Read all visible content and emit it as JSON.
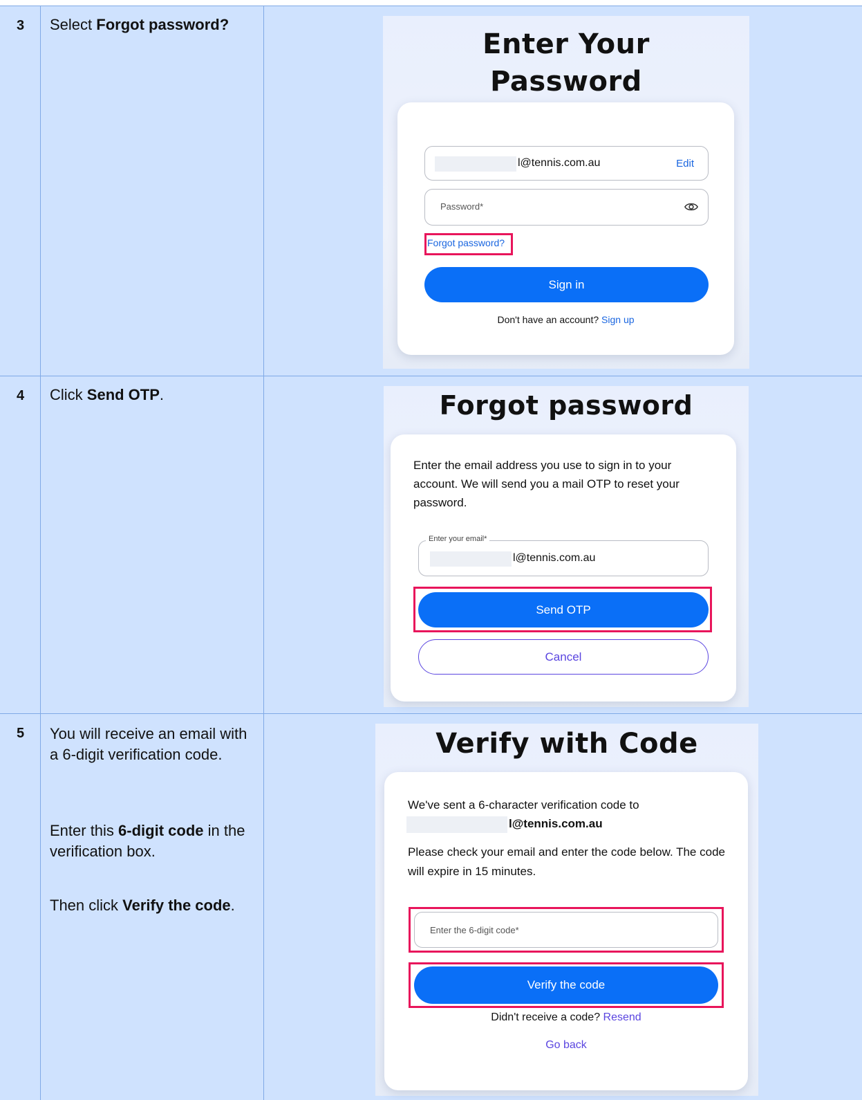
{
  "steps": [
    {
      "number": "3",
      "instruction": {
        "prefix": "Select ",
        "bold": "Forgot password?"
      },
      "screen": {
        "title_line1": "Enter Your",
        "title_line2": "Password",
        "email_suffix": "l@tennis.com.au",
        "edit_label": "Edit",
        "password_placeholder": "Password*",
        "forgot_link": "Forgot password?",
        "signin_label": "Sign in",
        "no_account_text": "Don't have an account?",
        "signup_link": "Sign up"
      }
    },
    {
      "number": "4",
      "instruction": {
        "prefix": "Click ",
        "bold": "Send OTP",
        "suffix": "."
      },
      "screen": {
        "title": "Forgot password",
        "description": "Enter the email address you use to sign in to your account. We will send you a mail OTP to reset your password.",
        "email_label": "Enter your email*",
        "email_suffix": "l@tennis.com.au",
        "send_label": "Send OTP",
        "cancel_label": "Cancel"
      }
    },
    {
      "number": "5",
      "instruction": {
        "para1": "You will receive an email with a 6-digit verification code.",
        "para2_prefix": "Enter this ",
        "para2_bold": "6-digit code",
        "para2_suffix": " in the verification box.",
        "para3_prefix": "Then click ",
        "para3_bold": "Verify the code",
        "para3_suffix": "."
      },
      "screen": {
        "title": "Verify with Code",
        "sent_text": "We've sent a 6-character verification code to",
        "email_suffix": "l@tennis.com.au",
        "check_text": "Please check your email and enter the code below. The code will expire in 15 minutes.",
        "code_placeholder": "Enter the 6-digit code*",
        "verify_label": "Verify the code",
        "no_code_text": "Didn't receive a code?",
        "resend_link": "Resend",
        "go_back_link": "Go back"
      }
    }
  ],
  "colors": {
    "row_background": "#cfe2fe",
    "primary_button": "#0a6ff7",
    "highlight_border": "#e8155b",
    "link": "#1a66e0",
    "secondary_link": "#5a45e0"
  }
}
